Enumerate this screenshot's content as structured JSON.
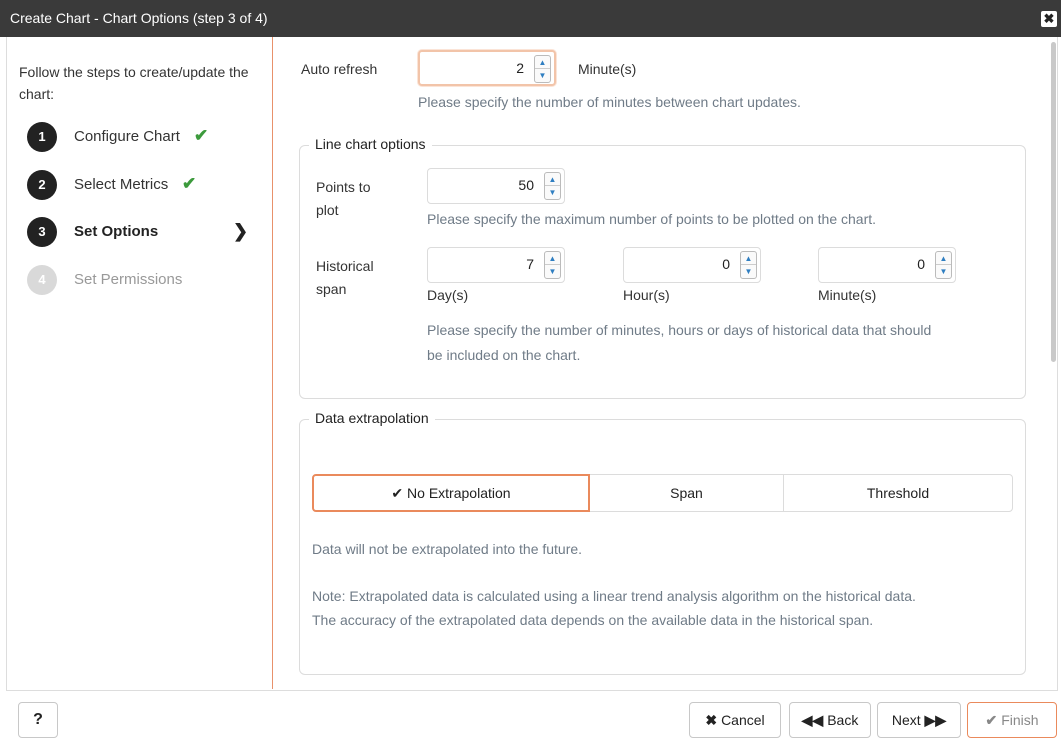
{
  "dialog": {
    "title": "Create Chart - Chart Options (step 3 of 4)",
    "close_icon": "close-icon"
  },
  "sidebar": {
    "intro": "Follow the steps to create/update the chart:",
    "steps": [
      {
        "number": "1",
        "label": "Configure Chart",
        "status": "complete"
      },
      {
        "number": "2",
        "label": "Select Metrics",
        "status": "complete"
      },
      {
        "number": "3",
        "label": "Set Options",
        "status": "active"
      },
      {
        "number": "4",
        "label": "Set Permissions",
        "status": "disabled"
      }
    ],
    "check_glyph": "✔",
    "arrow_glyph": "❯"
  },
  "auto_refresh": {
    "label": "Auto refresh",
    "value": "2",
    "unit": "Minute(s)",
    "hint": "Please specify the number of minutes between chart updates."
  },
  "line_chart": {
    "legend": "Line chart options",
    "points": {
      "label_line1": "Points to",
      "label_line2": "plot",
      "value": "50",
      "hint": "Please specify the maximum number of points to be plotted on the chart."
    },
    "historical": {
      "label_line1": "Historical",
      "label_line2": "span",
      "days_value": "7",
      "days_unit": "Day(s)",
      "hours_value": "0",
      "hours_unit": "Hour(s)",
      "minutes_value": "0",
      "minutes_unit": "Minute(s)",
      "hint_line1": "Please specify the number of minutes, hours or days of historical data that should",
      "hint_line2": "be included on the chart."
    }
  },
  "extrapolation": {
    "legend": "Data extrapolation",
    "options": [
      {
        "label": "No Extrapolation",
        "selected": true
      },
      {
        "label": "Span",
        "selected": false
      },
      {
        "label": "Threshold",
        "selected": false
      }
    ],
    "selected_glyph": "✔",
    "info": "Data will not be extrapolated into the future.",
    "note_line1": "Note: Extrapolated data is calculated using a linear trend analysis algorithm on the historical data.",
    "note_line2": "The accuracy of the extrapolated data depends on the available data in the historical span."
  },
  "footer": {
    "help_label": "?",
    "cancel_label": "Cancel",
    "back_label": "Back",
    "next_label": "Next",
    "finish_label": "Finish"
  },
  "colors": {
    "accent": "#ea8a5c",
    "check": "#3c9a3c",
    "titlebar": "#3a3a3a",
    "hint": "#6f7b87"
  }
}
